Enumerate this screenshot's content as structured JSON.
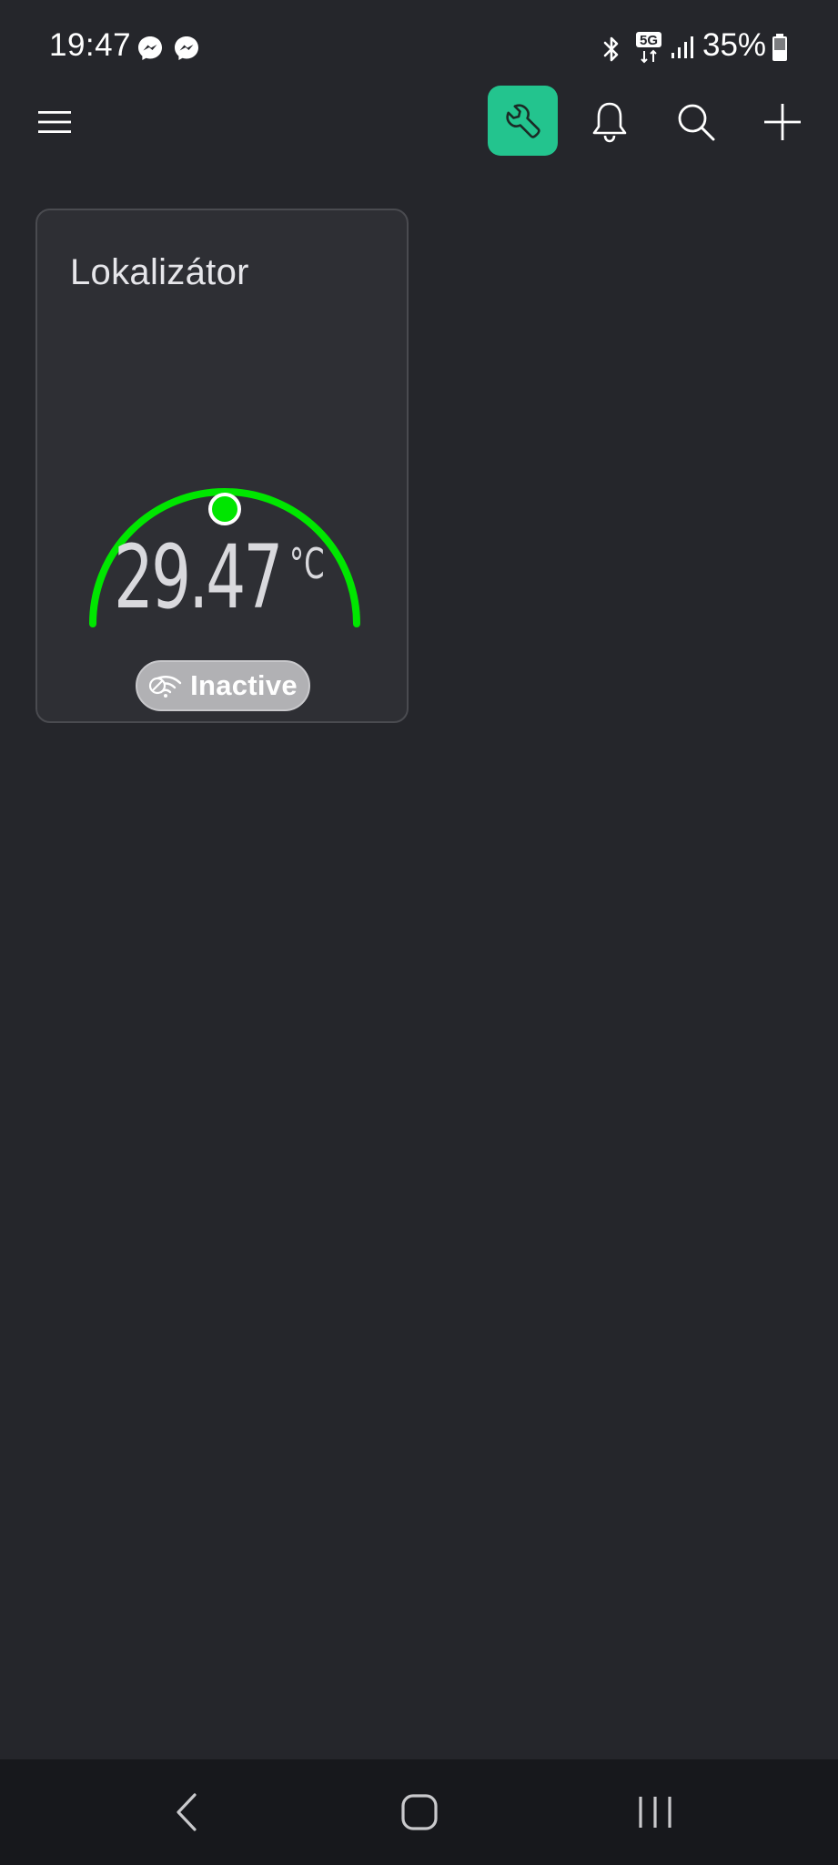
{
  "status_bar": {
    "time": "19:47",
    "battery_percent": "35%",
    "network_badge": "5G",
    "notification_icons": [
      "messenger-icon",
      "messenger-icon"
    ],
    "system_icons": [
      "bluetooth-icon",
      "5g-data-icon",
      "signal-strength-icon",
      "battery-icon"
    ]
  },
  "app_bar": {
    "menu_icon": "hamburger-menu-icon",
    "actions": [
      "wrench-icon",
      "bell-icon",
      "search-icon",
      "plus-icon"
    ],
    "accent_color": "#23c48e"
  },
  "widget": {
    "title": "Lokalizátor",
    "value": "29.47",
    "unit": "°C",
    "gauge_color": "#00e600",
    "gauge_level": 0.5,
    "status_label": "Inactive",
    "status_icon": "wifi-off-icon"
  },
  "nav_bar": {
    "buttons": [
      "back-icon",
      "home-icon",
      "recent-apps-icon"
    ]
  },
  "colors": {
    "background": "#25262b",
    "card": "#2e2f34",
    "nav_bar": "#17181c",
    "inactive_pill": "#b1b1b4"
  }
}
